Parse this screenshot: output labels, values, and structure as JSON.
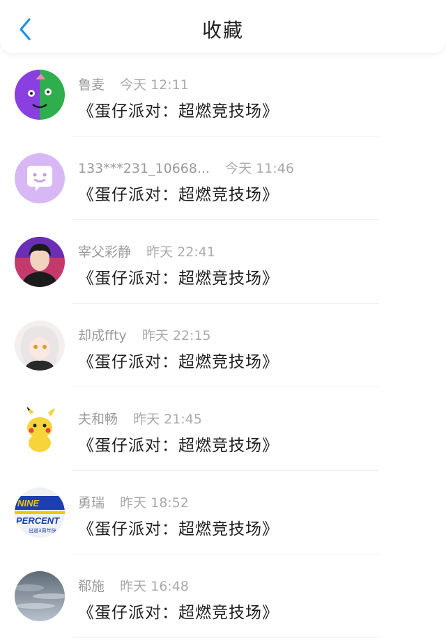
{
  "header": {
    "title": "收藏",
    "back_icon": "chevron-left-icon",
    "accent_color": "#1e90e6"
  },
  "favorites": [
    {
      "name": "鲁麦",
      "time": "今天 12:11",
      "message": "《蛋仔派对：超燃竞技场》",
      "avatar": "cartoon-face-avatar"
    },
    {
      "name": "133***231_10668...",
      "time": "今天 11:46",
      "message": "《蛋仔派对：超燃竞技场》",
      "avatar": "chat-bubble-avatar"
    },
    {
      "name": "宰父彩静",
      "time": "昨天 22:41",
      "message": "《蛋仔派对：超燃竞技场》",
      "avatar": "person-photo-avatar"
    },
    {
      "name": "却成ffty",
      "time": "昨天 22:15",
      "message": "《蛋仔派对：超燃竞技场》",
      "avatar": "anime-character-avatar"
    },
    {
      "name": "夫和畅",
      "time": "昨天 21:45",
      "message": "《蛋仔派对：超燃竞技场》",
      "avatar": "pikachu-avatar"
    },
    {
      "name": "勇瑞",
      "time": "昨天 18:52",
      "message": "《蛋仔派对：超燃竞技场》",
      "avatar": "nine-percent-logo-avatar",
      "avatar_text": [
        "NINE",
        "PERCENT",
        "出道3周年快"
      ]
    },
    {
      "name": "郗施",
      "time": "昨天 16:48",
      "message": "《蛋仔派对：超燃竞技场》",
      "avatar": "sky-photo-avatar"
    }
  ]
}
